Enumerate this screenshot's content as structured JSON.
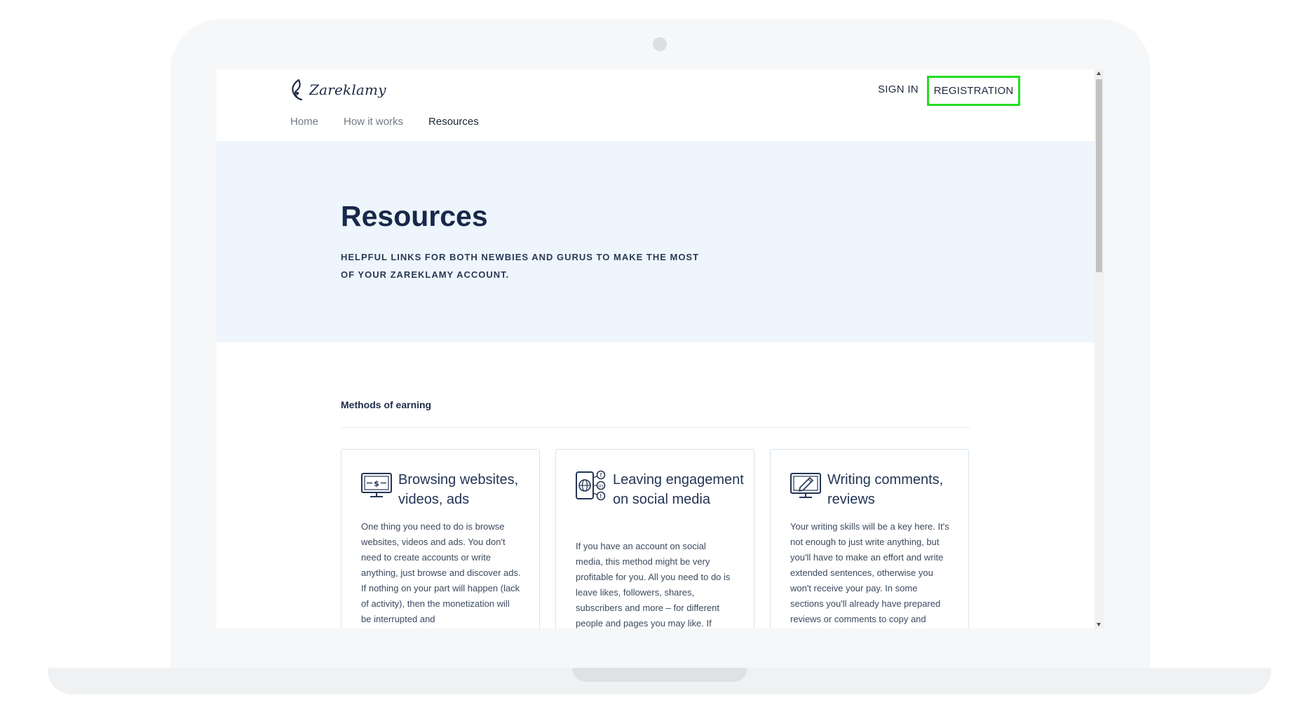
{
  "brand": {
    "name": "Zareklamy"
  },
  "header": {
    "signin_label": "SIGN IN",
    "registration_label": "REGISTRATION"
  },
  "nav": {
    "items": [
      {
        "label": "Home"
      },
      {
        "label": "How it works"
      },
      {
        "label": "Resources"
      }
    ]
  },
  "hero": {
    "title": "Resources",
    "subtitle": "HELPFUL LINKS FOR BOTH NEWBIES AND GURUS TO MAKE THE MOST OF YOUR ZAREKLAMY ACCOUNT."
  },
  "section": {
    "title": "Methods of earning"
  },
  "cards": [
    {
      "icon": "monitor-money-icon",
      "title": "Browsing websites, videos, ads",
      "text": "One thing you need to do is browse websites, videos and ads. You don't need to create accounts or write anything, just browse and discover ads. If nothing on your part will happen (lack of activity), then the monetization will be interrupted and"
    },
    {
      "icon": "social-media-icon",
      "title": "Leaving engagement on social media",
      "text": "If you have an account on social media, this method might be very profitable for you. All you need to do is leave likes, followers, shares, subscribers and more – for different people and pages you may like. If"
    },
    {
      "icon": "monitor-pencil-icon",
      "title": "Writing comments, reviews",
      "text": "Your writing skills will be a key here. It's not enough to just write anything, but you'll have to make an effort and write extended sentences, otherwise you won't receive your pay. In some sections you'll already have prepared reviews or comments to copy and"
    }
  ],
  "colors": {
    "accent_outline": "#22dd22",
    "hero_bg": "#eef5fc",
    "heading": "#18284a"
  }
}
